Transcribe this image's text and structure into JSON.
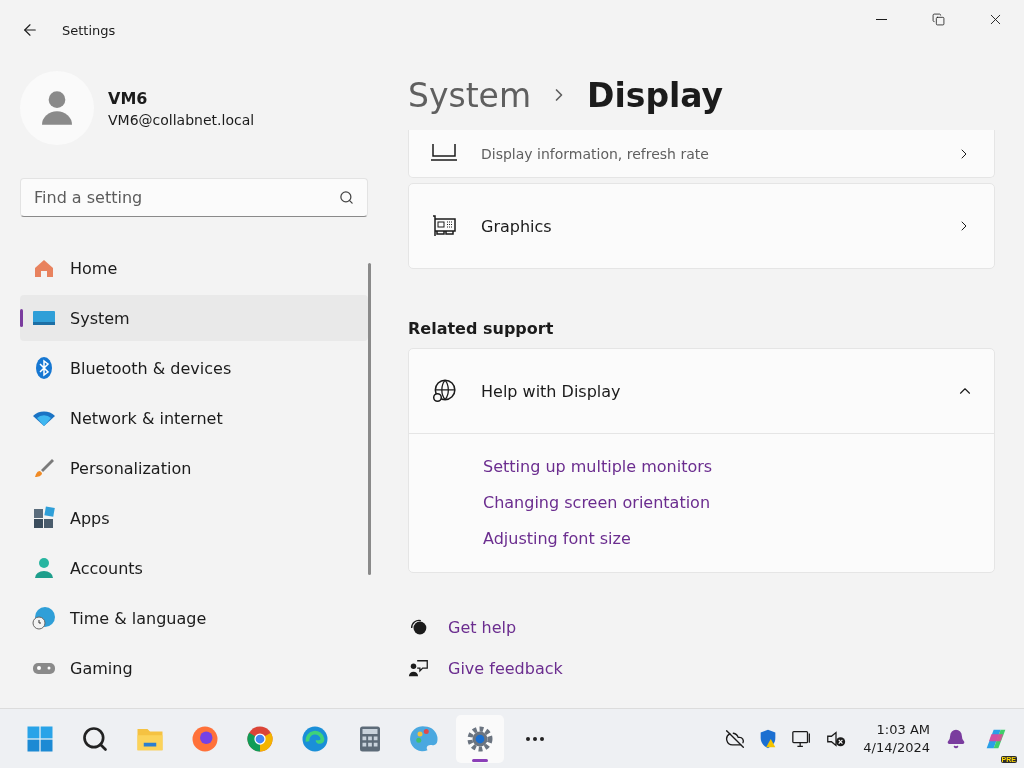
{
  "window": {
    "title": "Settings"
  },
  "account": {
    "name": "VM6",
    "email": "VM6@collabnet.local"
  },
  "search": {
    "placeholder": "Find a setting"
  },
  "nav": [
    {
      "label": "Home",
      "selected": false
    },
    {
      "label": "System",
      "selected": true
    },
    {
      "label": "Bluetooth & devices",
      "selected": false
    },
    {
      "label": "Network & internet",
      "selected": false
    },
    {
      "label": "Personalization",
      "selected": false
    },
    {
      "label": "Apps",
      "selected": false
    },
    {
      "label": "Accounts",
      "selected": false
    },
    {
      "label": "Time & language",
      "selected": false
    },
    {
      "label": "Gaming",
      "selected": false
    }
  ],
  "breadcrumb": [
    "System",
    "Display"
  ],
  "advanced_display": {
    "subtitle": "Display information, refresh rate"
  },
  "graphics": {
    "title": "Graphics"
  },
  "related_support": {
    "heading": "Related support",
    "help": {
      "title": "Help with Display",
      "expanded": true,
      "links": [
        "Setting up multiple monitors",
        "Changing screen orientation",
        "Adjusting font size"
      ]
    }
  },
  "footer_links": [
    "Get help",
    "Give feedback"
  ],
  "taskbar": {
    "pinned": [
      {
        "selected": false
      },
      {
        "selected": false
      },
      {
        "selected": false
      },
      {
        "selected": false
      },
      {
        "selected": false
      },
      {
        "selected": false
      },
      {
        "selected": false
      },
      {
        "selected": false
      },
      {
        "selected": true
      },
      {
        "selected": false
      }
    ],
    "copilot_badge": "PRE",
    "time": "1:03 AM",
    "date": "4/14/2024"
  }
}
